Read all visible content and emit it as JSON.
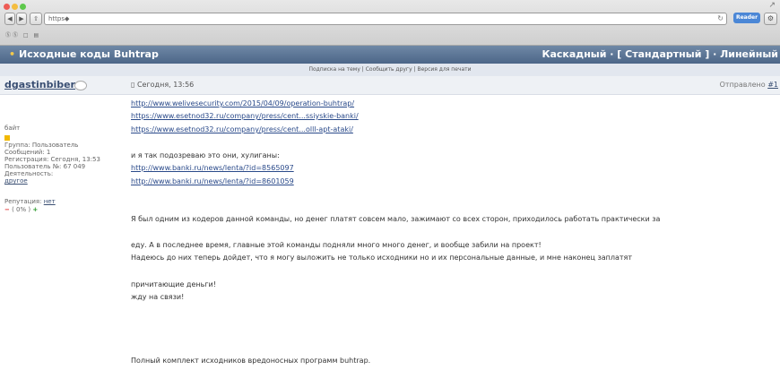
{
  "browser": {
    "url_text": "https◆",
    "reload_icon": "↻",
    "reader_label": "Reader",
    "back_icon": "◀",
    "forward_icon": "▶",
    "share_icon": "⇧",
    "tool_icon": "⚙",
    "bookmarks_text": "ⓈⓈ □ ▤",
    "resize_icon": "↗",
    "traffic_colors": [
      "#ee5c55",
      "#f4bd3f",
      "#5dc84b"
    ]
  },
  "topic": {
    "title": "Исходные коды Buhtrap",
    "view_modes": "Каскадный · [ Стандартный ] · Линейный",
    "options": "Подписка на тему | Сообщить другу | Версия для печати"
  },
  "author": {
    "name": "dgastinbiber",
    "post_date": "Сегодня, 13:56",
    "sent_label": "Отправлено ",
    "sent_num": "#1"
  },
  "sidebar": {
    "title": "байт",
    "group": "Группа: Пользователь",
    "messages": "Сообщений: 1",
    "registration": "Регистрация: Сегодня, 13:53",
    "user_no": "Пользователь №: 67 049",
    "activity_label": "Деятельность: ",
    "activity_value": "другое",
    "rep_label": "Репутация: ",
    "rep_value": "нет",
    "rep_minus": "−",
    "rep_pct": " ( 0% ) ",
    "rep_plus": "+"
  },
  "post": {
    "links1": [
      "http://www.welivesecurity.com/2015/04/09/operation-buhtrap/",
      "https://www.esetnod32.ru/company/press/cent...ssiyskie-banki/",
      "https://www.esetnod32.ru/company/press/cent...olll-apt-ataki/"
    ],
    "suspect": "и я так подозреваю это они, хулиганы:",
    "links2": [
      "http://www.banki.ru/news/lenta/?id=8565097",
      "http://www.banki.ru/news/lenta/?id=8601059"
    ],
    "p1": "Я был одним из кодеров данной команды, но денег платят совсем мало, зажимают со всех сторон, приходилось работать практически за",
    "p2": "еду. А в последнее время, главные этой команды подняли много много денег, и вообще забили на проект!",
    "p3": "Надеюсь до них теперь дойдет, что я могу выложить не только исходники но и их персональные данные, и мне наконец заплатят",
    "p4": "причитающие деньги!",
    "p5": "жду на связи!",
    "p6": "Полный комплект исходников вредоносных программ buhtrap."
  }
}
